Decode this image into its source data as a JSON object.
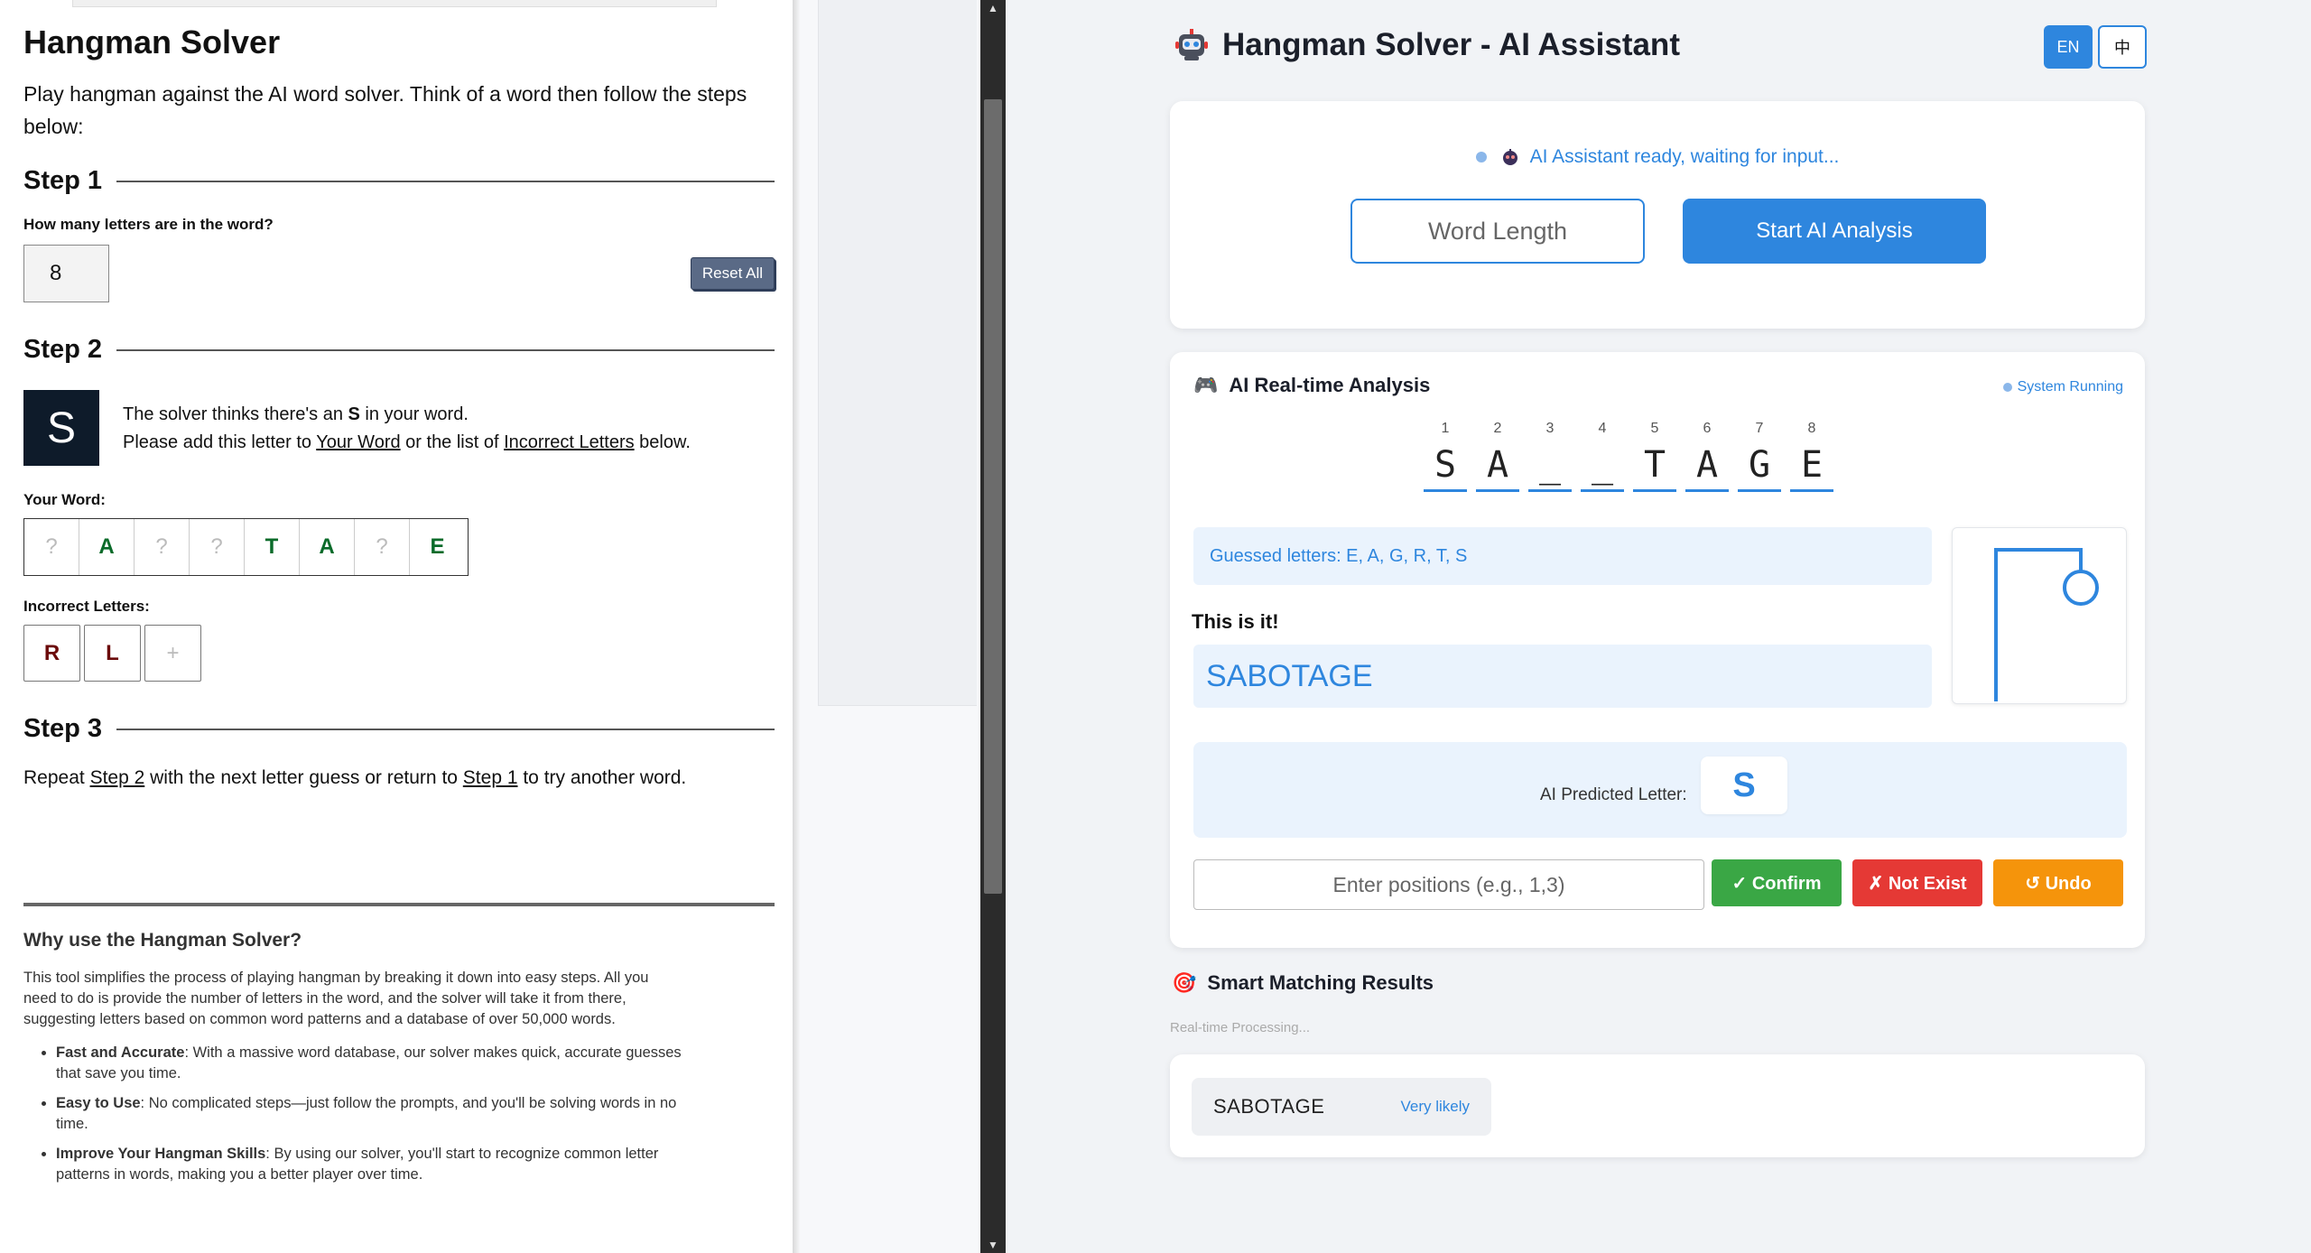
{
  "left": {
    "title": "Hangman Solver",
    "intro": "Play hangman against the AI word solver. Think of a word then follow the steps below:",
    "step1": {
      "heading": "Step 1",
      "question": "How many letters are in the word?",
      "count": "8",
      "reset_label": "Reset All"
    },
    "step2": {
      "heading": "Step 2",
      "suggested_letter": "S",
      "line1_pre": "The solver thinks there's an ",
      "line1_letter": "S",
      "line1_post": " in your word.",
      "line2_pre": "Please add this letter to ",
      "line2_link1": "Your Word",
      "line2_mid": " or the list of ",
      "line2_link2": "Incorrect Letters",
      "line2_post": " below.",
      "your_word_label": "Your Word:",
      "your_word": [
        "?",
        "A",
        "?",
        "?",
        "T",
        "A",
        "?",
        "E"
      ],
      "incorrect_label": "Incorrect Letters:",
      "incorrect": [
        "R",
        "L"
      ],
      "add_symbol": "+"
    },
    "step3": {
      "heading": "Step 3",
      "text_pre": "Repeat ",
      "link1": "Step 2",
      "text_mid": " with the next letter guess or return to ",
      "link2": "Step 1",
      "text_post": " to try another word."
    },
    "why": {
      "title": "Why use the Hangman Solver?",
      "body": "This tool simplifies the process of playing hangman by breaking it down into easy steps. All you need to do is provide the number of letters in the word, and the solver will take it from there, suggesting letters based on common word patterns and a database of over 50,000 words.",
      "bullets": [
        {
          "bold": "Fast and Accurate",
          "text": ": With a massive word database, our solver makes quick, accurate guesses that save you time."
        },
        {
          "bold": "Easy to Use",
          "text": ": No complicated steps—just follow the prompts, and you'll be solving words in no time."
        },
        {
          "bold": "Improve Your Hangman Skills",
          "text": ": By using our solver, you'll start to recognize common letter patterns in words, making you a better player over time."
        }
      ]
    }
  },
  "right": {
    "title": "Hangman Solver - AI Assistant",
    "lang_en": "EN",
    "lang_zh": "中",
    "status": "AI Assistant ready, waiting for input...",
    "word_length_placeholder": "Word Length",
    "start_label": "Start AI Analysis",
    "analysis_title": "AI Real-time Analysis",
    "system_status": "System Running",
    "pattern": [
      {
        "n": "1",
        "c": "S"
      },
      {
        "n": "2",
        "c": "A"
      },
      {
        "n": "3",
        "c": "_"
      },
      {
        "n": "4",
        "c": "_"
      },
      {
        "n": "5",
        "c": "T"
      },
      {
        "n": "6",
        "c": "A"
      },
      {
        "n": "7",
        "c": "G"
      },
      {
        "n": "8",
        "c": "E"
      }
    ],
    "guessed": "Guessed letters: E, A, G, R, T, S",
    "this_is_it": "This is it!",
    "answer": "SABOTAGE",
    "predicted_label": "AI Predicted Letter:",
    "predicted_letter": "S",
    "positions_placeholder": "Enter positions (e.g., 1,3)",
    "confirm_label": "✓ Confirm",
    "notexist_label": "✗ Not Exist",
    "undo_label": "↺ Undo",
    "matching_title": "Smart Matching Results",
    "processing": "Real-time Processing...",
    "results": [
      {
        "word": "SABOTAGE",
        "likelihood": "Very likely"
      }
    ]
  },
  "colors": {
    "accent": "#2e86de",
    "confirm": "#3aa745",
    "not_exist": "#e53935",
    "undo": "#f5940b"
  },
  "icons": {
    "robot": "robot-icon",
    "gamepad": "gamepad-icon",
    "target": "target-icon"
  }
}
